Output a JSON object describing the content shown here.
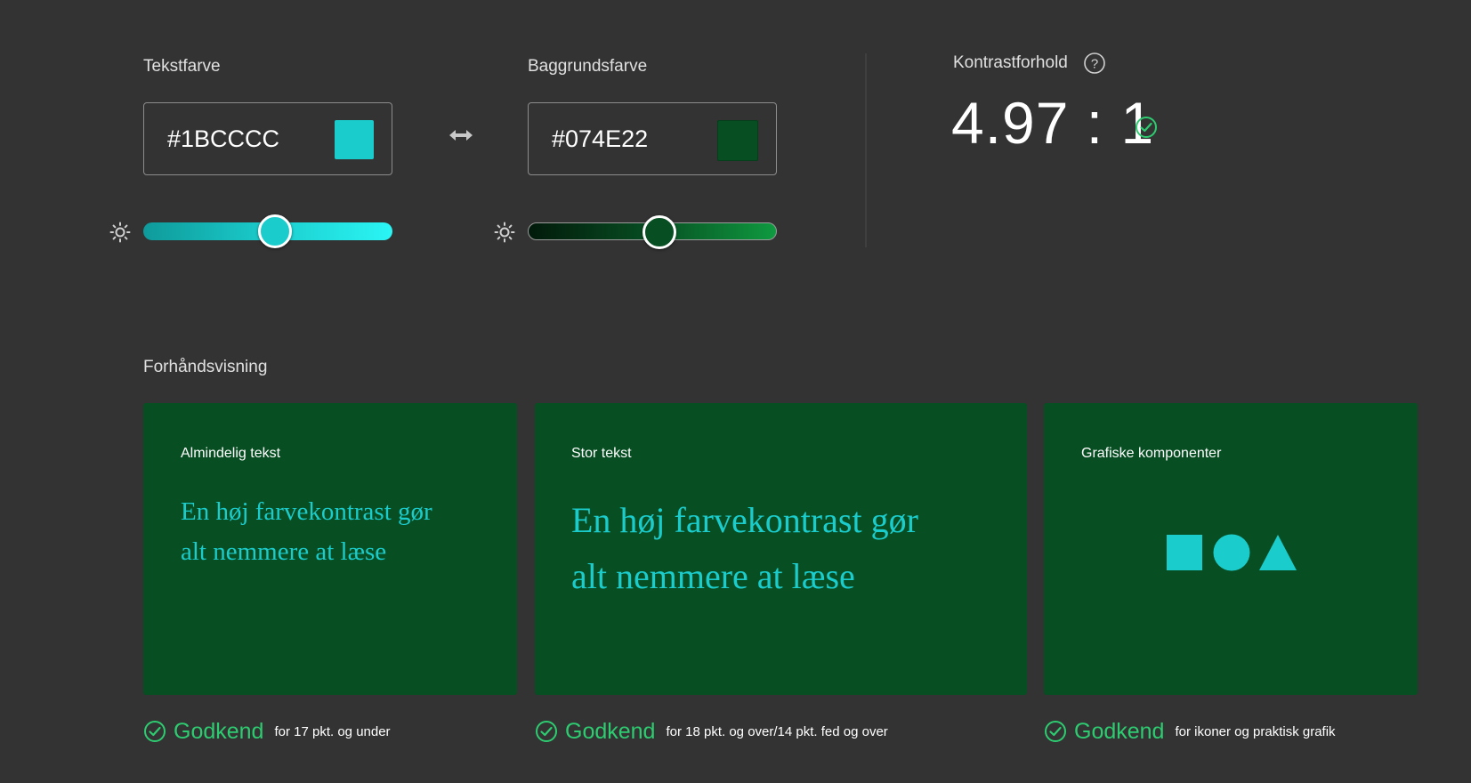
{
  "colors": {
    "page_bg": "#333333",
    "text_color": "#1BCCCC",
    "background_color": "#074E22",
    "pass_green": "#2ECC71"
  },
  "text_color_section": {
    "label": "Tekstfarve",
    "value": "#1BCCCC",
    "brightness_level": 0.53
  },
  "swap": {
    "icon": "swap-arrows-icon"
  },
  "background_color_section": {
    "label": "Baggrundsfarve",
    "value": "#074E22",
    "brightness_level": 0.53
  },
  "contrast": {
    "label": "Kontrastforhold",
    "help_icon": "help-icon",
    "ratio": "4.97 : 1",
    "status_icon": "check-circle-icon"
  },
  "preview": {
    "heading": "Forhåndsvisning",
    "cards": [
      {
        "title": "Almindelig tekst",
        "sample_line1": "En høj farvekontrast gør",
        "sample_line2": "alt nemmere at læse",
        "result": "Godkend",
        "description": "for 17 pkt. og under"
      },
      {
        "title": "Stor tekst",
        "sample_line1": "En høj farvekontrast gør",
        "sample_line2": "alt nemmere at læse",
        "result": "Godkend",
        "description": "for 18 pkt. og over/14 pkt. fed og over"
      },
      {
        "title": "Grafiske komponenter",
        "shapes": [
          "square-icon",
          "circle-icon",
          "triangle-icon"
        ],
        "result": "Godkend",
        "description": "for ikoner og praktisk grafik"
      }
    ]
  }
}
